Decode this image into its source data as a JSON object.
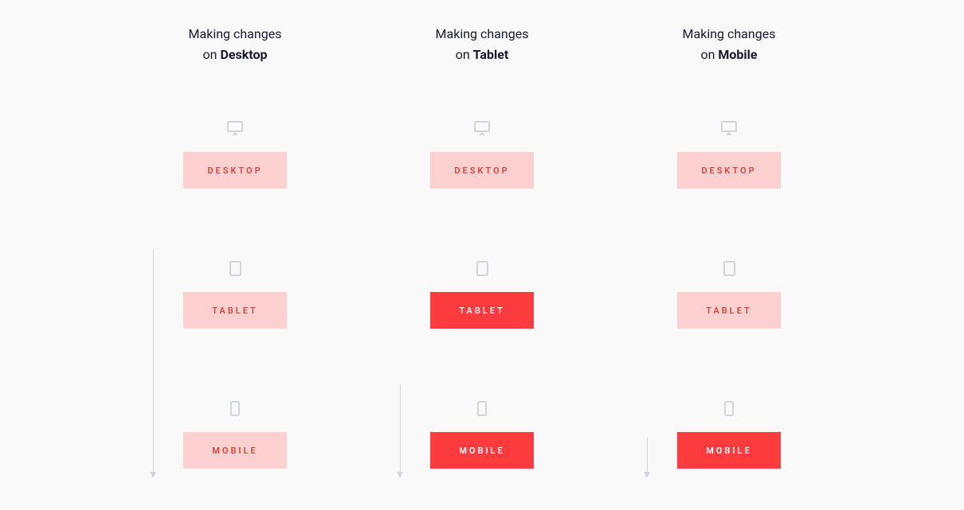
{
  "columns": [
    {
      "heading_line1": "Making changes",
      "heading_line2_prefix": "on ",
      "heading_line2_bold": "Desktop",
      "arrow": "long",
      "blocks": [
        {
          "icon": "desktop",
          "label": "DESKTOP",
          "style": "light"
        },
        {
          "icon": "tablet",
          "label": "TABLET",
          "style": "light"
        },
        {
          "icon": "mobile",
          "label": "MOBILE",
          "style": "light"
        }
      ]
    },
    {
      "heading_line1": "Making changes",
      "heading_line2_prefix": "on ",
      "heading_line2_bold": "Tablet",
      "arrow": "med",
      "blocks": [
        {
          "icon": "desktop",
          "label": "DESKTOP",
          "style": "light"
        },
        {
          "icon": "tablet",
          "label": "TABLET",
          "style": "solid"
        },
        {
          "icon": "mobile",
          "label": "MOBILE",
          "style": "solid"
        }
      ]
    },
    {
      "heading_line1": "Making changes",
      "heading_line2_prefix": "on ",
      "heading_line2_bold": "Mobile",
      "arrow": "short",
      "blocks": [
        {
          "icon": "desktop",
          "label": "DESKTOP",
          "style": "light"
        },
        {
          "icon": "tablet",
          "label": "TABLET",
          "style": "light"
        },
        {
          "icon": "mobile",
          "label": "MOBILE",
          "style": "solid"
        }
      ]
    }
  ]
}
